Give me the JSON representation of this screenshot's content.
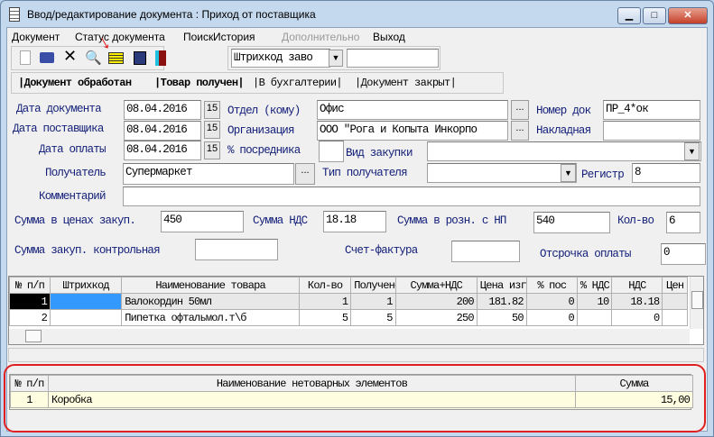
{
  "window": {
    "title": "Ввод/редактирование документа : Приход от поставщика",
    "min": "▁",
    "max": "□",
    "close": "✕"
  },
  "menu": [
    "Документ",
    "Статус документа",
    "Поиск",
    "История",
    "Дополнительно",
    "Выход"
  ],
  "toolbar": {
    "barcode_select": "Штрихкод заво",
    "barcode_value": ""
  },
  "status_bar": {
    "processed": "|Документ обработан",
    "received": "|Товар получен|",
    "accounting": "|В бухгалтерии|",
    "closed": "|Документ закрыт|"
  },
  "form": {
    "doc_date_label": "Дата документа",
    "doc_date": "08.04.2016",
    "supplier_date_label": "Дата поставщика",
    "supplier_date": "08.04.2016",
    "pay_date_label": "Дата оплаты",
    "pay_date": "08.04.2016",
    "dept_label": "Отдел (кому)",
    "dept": "Офис",
    "org_label": "Организация",
    "org": "ООО \"Рога и Копыта Инкорпо",
    "broker_label": "% посредника",
    "broker": "",
    "doc_no_label": "Номер док",
    "doc_no": "ПР_4*ок",
    "invoice_label": "Накладная",
    "invoice": "",
    "purchase_type_label": "Вид закупки",
    "purchase_type": "",
    "recipient_label": "Получатель",
    "recipient": "Супермаркет",
    "recipient_type_label": "Тип получателя",
    "recipient_type": "",
    "register_label": "Регистр",
    "register": "8",
    "comment_label": "Комментарий",
    "comment": "",
    "sum_purchase_label": "Сумма в ценах закуп.",
    "sum_purchase": "450",
    "vat_label": "Сумма НДС",
    "vat": "18.18",
    "sum_retail_label": "Сумма в розн. с НП",
    "sum_retail": "540",
    "qty_label": "Кол-во",
    "qty": "6",
    "sum_control_label": "Сумма закуп. контрольная",
    "sum_control": "",
    "invoice_f_label": "Счет-фактура",
    "invoice_f": "",
    "delay_label": "Отсрочка оплаты",
    "delay": "0",
    "ellipsis": "...",
    "calendar": "15",
    "dropdown": "▼"
  },
  "items_table": {
    "columns": [
      "№ п/п",
      "Штрихкод",
      "Наименование  товара",
      "Кол-во",
      "Получено",
      "Сумма+НДС",
      "Цена изг",
      "% пос",
      "% НДС",
      "НДС",
      "Цен"
    ],
    "rows": [
      [
        "1",
        "",
        "Валокордин 50мл",
        "1",
        "1",
        "200",
        "181.82",
        "0",
        "10",
        "18.18",
        ""
      ],
      [
        "2",
        "",
        "Пипетка офтальмол.т\\б",
        "5",
        "5",
        "250",
        "50",
        "0",
        "",
        "0",
        ""
      ]
    ]
  },
  "extra_table": {
    "columns": [
      "№ п/п",
      "Наименование нетоварных элементов",
      "Сумма"
    ],
    "rows": [
      [
        "1",
        "Коробка",
        "15,00"
      ]
    ]
  },
  "colors": {
    "highlight": "#ff0000",
    "selected_cell": "#3399ff",
    "row_bg": "#fffde0"
  }
}
